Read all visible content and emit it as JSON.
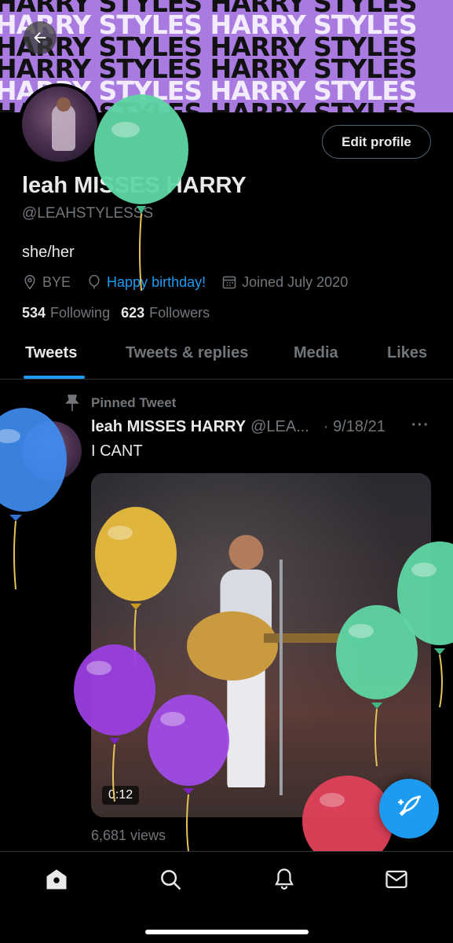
{
  "banner": {
    "text": "HARRY STYLES"
  },
  "profile": {
    "name": "leah MISSES HARRY",
    "handle": "@LEAHSTYLESSS",
    "bio": "she/her",
    "location": "BYE",
    "birthday_link": "Happy birthday!",
    "joined": "Joined July 2020",
    "following_count": "534",
    "following_label": "Following",
    "followers_count": "623",
    "followers_label": "Followers",
    "edit_button": "Edit profile"
  },
  "tabs": [
    {
      "label": "Tweets",
      "active": true
    },
    {
      "label": "Tweets & replies",
      "active": false
    },
    {
      "label": "Media",
      "active": false
    },
    {
      "label": "Likes",
      "active": false
    }
  ],
  "tweet": {
    "pinned_label": "Pinned Tweet",
    "author": "leah MISSES HARRY",
    "handle": "@LEA...",
    "date": "· 9/18/21",
    "more": "···",
    "text": "I CANT",
    "video_duration": "0:12",
    "views": "6,681 views"
  },
  "colors": {
    "accent": "#1d9bf0",
    "banner": "#a97be0",
    "background": "#000000",
    "muted_text": "#71767b"
  },
  "icons": [
    "back-arrow-icon",
    "location-icon",
    "balloon-icon",
    "calendar-icon",
    "pin-icon",
    "more-icon",
    "compose-icon",
    "home-icon",
    "search-icon",
    "notifications-icon",
    "messages-icon"
  ]
}
